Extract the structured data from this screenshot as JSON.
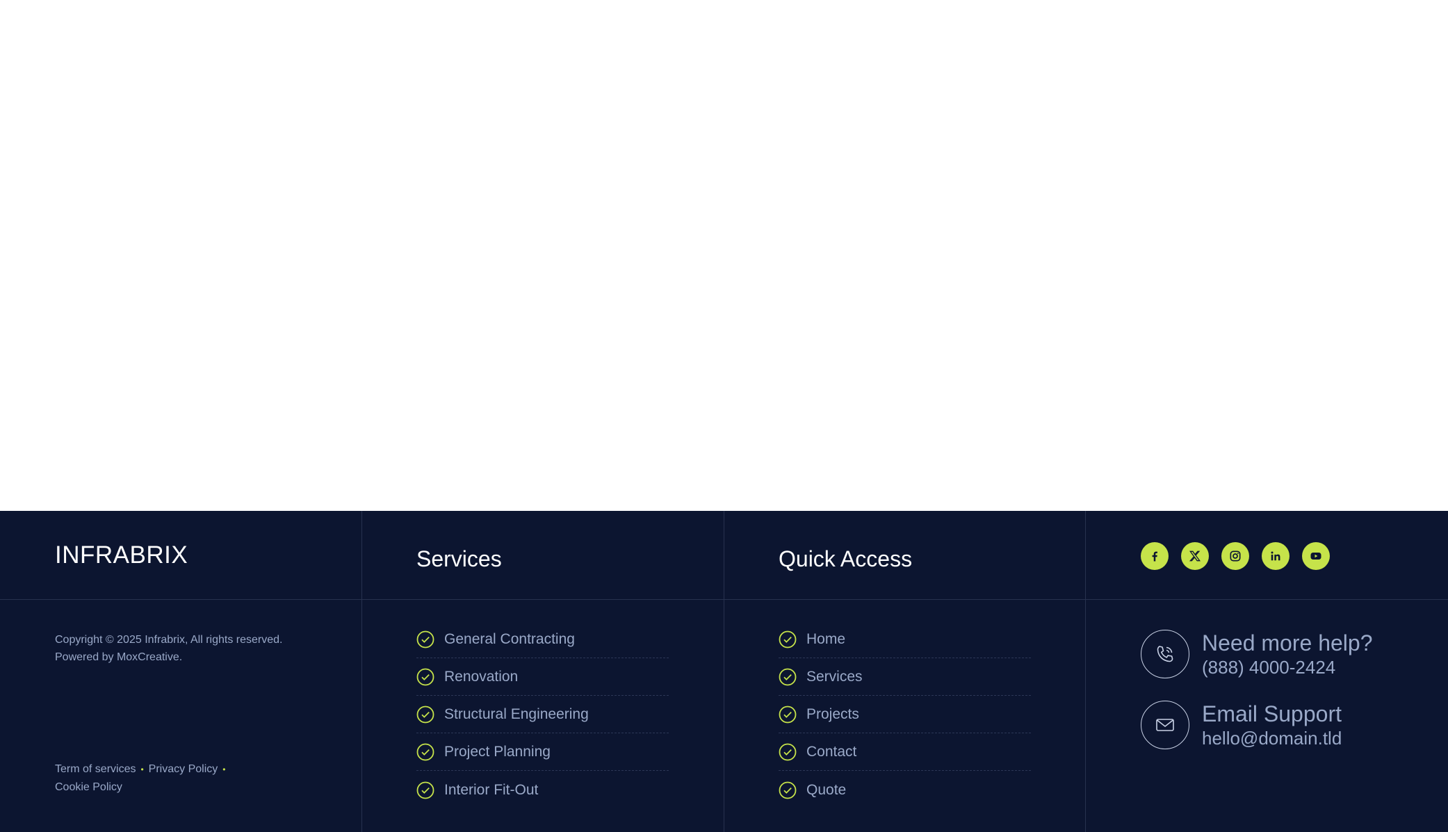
{
  "brand": {
    "logo_text": "INFRABRIX"
  },
  "footer": {
    "copyright_line1": "Copyright © 2025 Infrabrix, All rights reserved.",
    "copyright_line2": "Powered by MoxCreative.",
    "legal": {
      "terms": "Term of services",
      "privacy": "Privacy Policy",
      "cookie": "Cookie Policy",
      "separator": "•"
    },
    "services": {
      "title": "Services",
      "items": [
        "General Contracting",
        "Renovation",
        "Structural Engineering",
        "Project Planning",
        "Interior Fit-Out"
      ]
    },
    "quick_access": {
      "title": "Quick Access",
      "items": [
        "Home",
        "Services",
        "Projects",
        "Contact",
        "Quote"
      ]
    },
    "social": [
      "facebook-icon",
      "x-twitter-icon",
      "instagram-icon",
      "linkedin-icon",
      "youtube-icon"
    ],
    "help": {
      "title": "Need more help?",
      "value": "(888) 4000-2424"
    },
    "email": {
      "title": "Email Support",
      "value": "hello@domain.tld"
    }
  },
  "colors": {
    "background": "#0c1530",
    "accent": "#c6e34a",
    "text": "#9aa9c8",
    "divider": "#27324f"
  }
}
